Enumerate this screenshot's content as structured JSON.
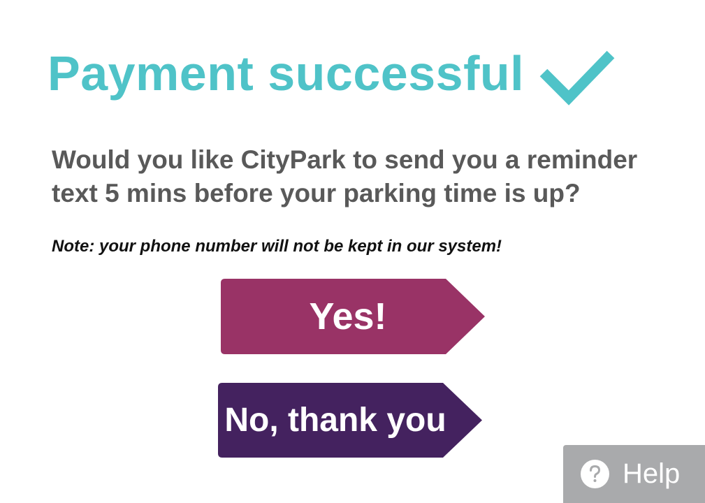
{
  "header": {
    "title": "Payment successful"
  },
  "prompt": {
    "question": "Would you like CityPark to send you a reminder text 5 mins before your parking time is up?",
    "note": "Note: your phone number will not be kept in our system!"
  },
  "actions": {
    "yes_label": "Yes!",
    "no_label": "No, thank you"
  },
  "help": {
    "label": "Help",
    "icon": "question-mark-icon"
  },
  "colors": {
    "title": "#4fc3c8",
    "yes_button": "#993366",
    "no_button": "#44225f",
    "help_button": "#a9aaac"
  }
}
